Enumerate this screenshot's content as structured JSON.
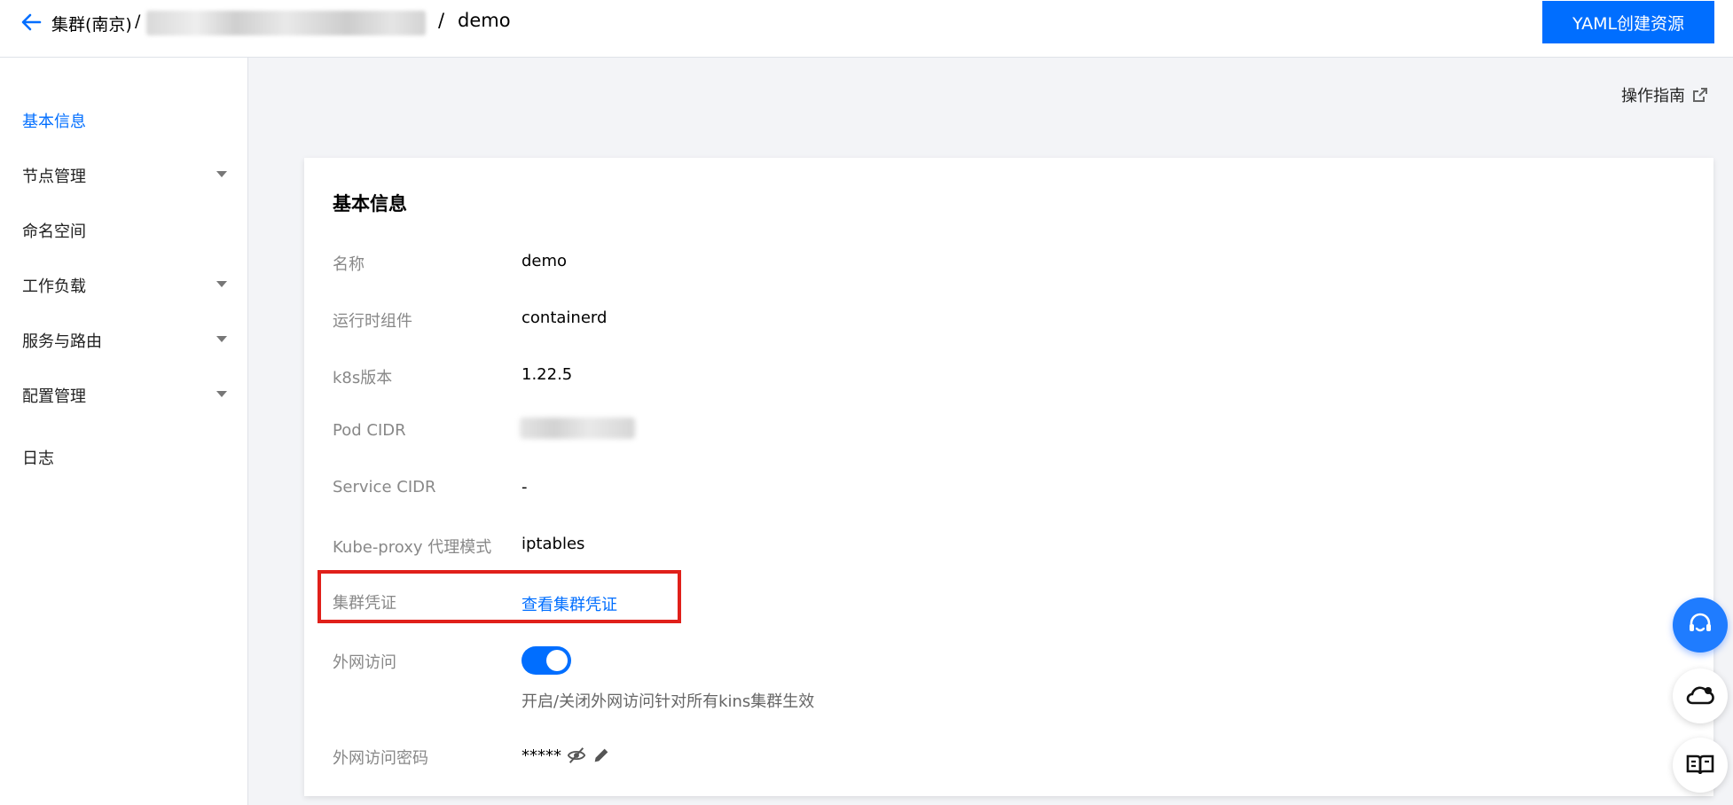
{
  "header": {
    "breadcrumb_root": "集群(南京)",
    "breadcrumb_sep": "/",
    "breadcrumb_current": "demo",
    "primary_button": "YAML创建资源"
  },
  "sidebar": {
    "items": [
      {
        "label": "基本信息",
        "active": true,
        "has_caret": false
      },
      {
        "label": "节点管理",
        "active": false,
        "has_caret": true
      },
      {
        "label": "命名空间",
        "active": false,
        "has_caret": false
      },
      {
        "label": "工作负载",
        "active": false,
        "has_caret": true
      },
      {
        "label": "服务与路由",
        "active": false,
        "has_caret": true
      },
      {
        "label": "配置管理",
        "active": false,
        "has_caret": true
      },
      {
        "label": "日志",
        "active": false,
        "has_caret": false
      }
    ]
  },
  "main": {
    "guide_link": "操作指南",
    "card": {
      "title": "基本信息",
      "fields": {
        "name": {
          "label": "名称",
          "value": "demo"
        },
        "runtime": {
          "label": "运行时组件",
          "value": "containerd"
        },
        "k8s_version": {
          "label": "k8s版本",
          "value": "1.22.5"
        },
        "pod_cidr": {
          "label": "Pod CIDR"
        },
        "service_cidr": {
          "label": "Service CIDR",
          "value": "-"
        },
        "kube_proxy": {
          "label": "Kube-proxy 代理模式",
          "value": "iptables"
        },
        "credential": {
          "label": "集群凭证",
          "link": "查看集群凭证"
        },
        "public_access": {
          "label": "外网访问",
          "enabled": true,
          "hint": "开启/关闭外网访问针对所有kins集群生效"
        },
        "public_password": {
          "label": "外网访问密码",
          "value": "*****"
        }
      }
    }
  },
  "colors": {
    "accent": "#006eff",
    "highlight": "#e0201a"
  },
  "icons": [
    "back-arrow-icon",
    "external-link-icon",
    "eye-off-icon",
    "edit-icon",
    "headset-icon",
    "cloud-bell-icon",
    "book-icon"
  ]
}
